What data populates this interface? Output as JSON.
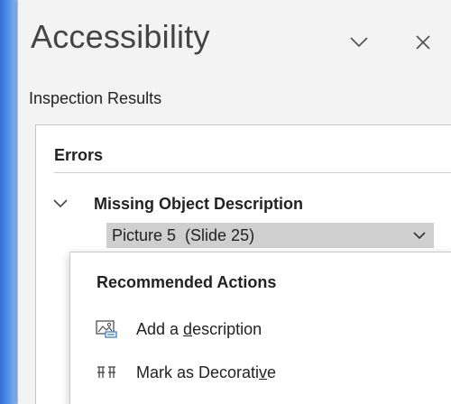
{
  "pane": {
    "title": "Accessibility",
    "subheading": "Inspection Results",
    "options_icon": "chevron-down-icon",
    "close_icon": "close-icon"
  },
  "results": {
    "section_header": "Errors",
    "issue": {
      "label": "Missing Object Description",
      "expanded": true,
      "selected_item": "Picture 5  (Slide 25)"
    }
  },
  "context_menu": {
    "header": "Recommended Actions",
    "items": [
      {
        "label_before": "Add a ",
        "accel": "d",
        "label_after": "escription",
        "icon": "image-description-icon"
      },
      {
        "label_before": "Mark as Decorati",
        "accel": "v",
        "label_after": "e",
        "icon": "decorative-icon"
      }
    ]
  },
  "colors": {
    "pane_bg": "#f3f3f3",
    "selected_bg": "#cfcfcf",
    "accent_blue": "#2f6fd6"
  }
}
